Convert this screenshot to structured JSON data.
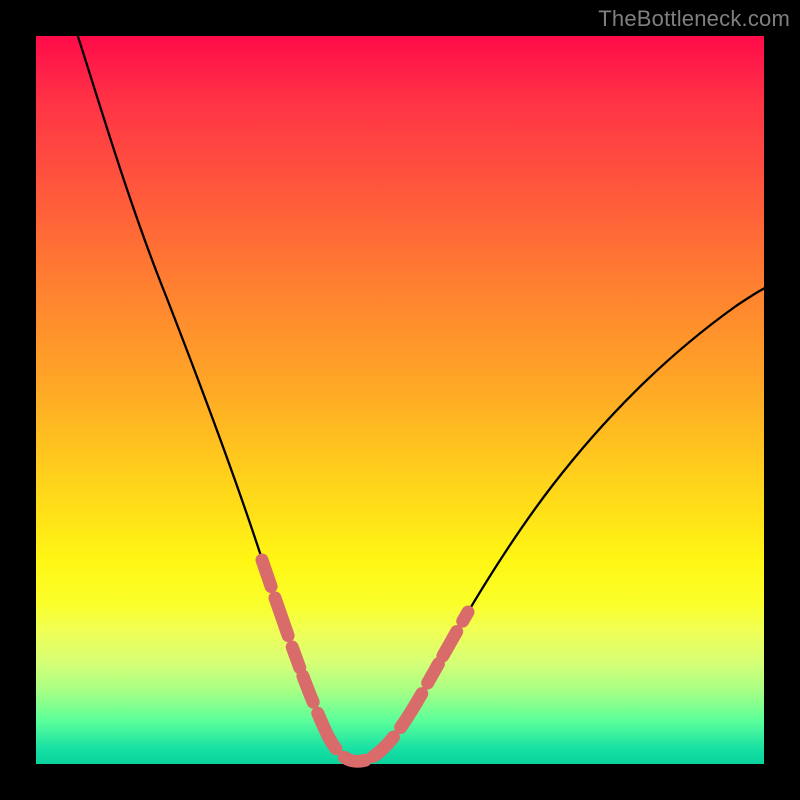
{
  "watermark": {
    "text": "TheBottleneck.com"
  },
  "colors": {
    "curve": "#000000",
    "dash": "#d96b6b",
    "gradient_top": "#ff0b49",
    "gradient_bottom": "#0ad29d",
    "background_outer": "#000000"
  },
  "chart_data": {
    "type": "line",
    "title": "",
    "xlabel": "",
    "ylabel": "",
    "xlim": [
      0,
      100
    ],
    "ylim": [
      0,
      100
    ],
    "grid": false,
    "legend": false,
    "series": [
      {
        "name": "bottleneck-curve",
        "x": [
          2,
          5,
          8,
          11,
          14,
          17,
          20,
          23,
          25,
          27,
          29,
          31,
          33,
          35,
          37,
          39,
          41,
          43,
          46,
          49,
          52,
          55,
          58,
          62,
          66,
          70,
          75,
          80,
          86,
          92,
          99
        ],
        "y": [
          100,
          92,
          83,
          74,
          65,
          56,
          47,
          39,
          33,
          27,
          22,
          17,
          13,
          9,
          6,
          3,
          1,
          0,
          2,
          6,
          11,
          17,
          23,
          30,
          37,
          43,
          50,
          56,
          62,
          67,
          72
        ]
      },
      {
        "name": "highlighted-segment",
        "x": [
          29,
          31,
          33,
          35,
          37,
          39,
          41,
          43,
          46,
          49,
          52,
          55
        ],
        "y": [
          22,
          17,
          13,
          9,
          6,
          3,
          1,
          0,
          2,
          6,
          11,
          17
        ]
      }
    ],
    "annotations": [
      {
        "type": "watermark",
        "text": "TheBottleneck.com",
        "position": "top-right"
      }
    ]
  }
}
